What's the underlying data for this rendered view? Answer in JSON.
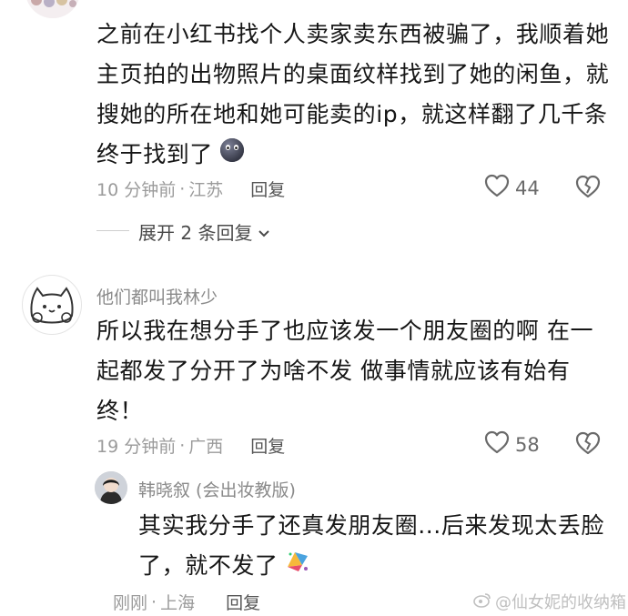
{
  "comments": [
    {
      "text_lines": [
        "之前在小红书找个人卖家卖东西被骗了，我顺着她",
        "主页拍的出物照片的桌面纹样找到了她的闲鱼，就",
        "搜她的所在地和她可能卖的ip，就这样翻了几千条",
        "终于找到了"
      ],
      "time": "10 分钟前",
      "location": "江苏",
      "reply_label": "回复",
      "likes": "44",
      "expand_label": "展开 2 条回复"
    },
    {
      "username": "他们都叫我林少",
      "text_lines": [
        "所以我在想分手了也应该发一个朋友圈的啊 在一",
        "起都发了分开了为啥不发 做事情就应该有始有",
        "终！"
      ],
      "time": "19 分钟前",
      "location": "广西",
      "reply_label": "回复",
      "likes": "58"
    }
  ],
  "reply": {
    "username": "韩晓叙 (会出妆教版)",
    "text_lines": [
      "其实我分手了还真发朋友圈...后来发现太丢脸",
      "了，就不发了"
    ],
    "time": "刚刚",
    "location": "上海",
    "reply_label": "回复"
  },
  "watermark": "@仙女妮的收纳箱",
  "colors": {
    "text": "#161616",
    "meta": "#9b9b9b",
    "divider": "#e6e6e6"
  }
}
